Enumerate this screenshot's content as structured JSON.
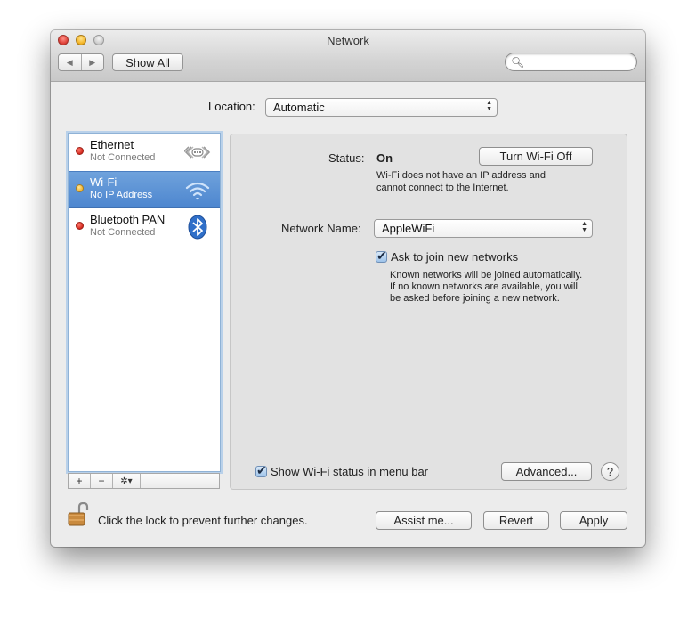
{
  "window": {
    "title": "Network",
    "nav_back": "◀",
    "nav_forward": "▶",
    "show_all_label": "Show All",
    "search_placeholder": "",
    "search_icon": "magnifier-icon"
  },
  "location": {
    "label": "Location:",
    "selected": "Automatic"
  },
  "services": [
    {
      "name": "Ethernet",
      "status": "Not Connected",
      "indicator": "red",
      "icon": "ethernet-icon",
      "selected": false
    },
    {
      "name": "Wi-Fi",
      "status": "No IP Address",
      "indicator": "yellow",
      "icon": "wifi-icon",
      "selected": true
    },
    {
      "name": "Bluetooth PAN",
      "status": "Not Connected",
      "indicator": "red",
      "icon": "bluetooth-icon",
      "selected": false
    }
  ],
  "list_tools": {
    "add": "+",
    "remove": "−",
    "action": "✲▾"
  },
  "detail": {
    "status_label": "Status:",
    "status_value": "On",
    "toggle_button": "Turn Wi-Fi Off",
    "status_desc_1": "Wi-Fi does not have an IP address and",
    "status_desc_2": "cannot connect to the Internet.",
    "network_name_label": "Network Name:",
    "network_name_value": "AppleWiFi",
    "ask_join_label": "Ask to join new networks",
    "ask_join_checked": true,
    "ask_desc_1": "Known networks will be joined automatically.",
    "ask_desc_2": "If no known networks are available, you will",
    "ask_desc_3": "be asked before joining a new network.",
    "show_status_label": "Show Wi-Fi status in menu bar",
    "show_status_checked": true,
    "advanced_button": "Advanced...",
    "help_button": "?"
  },
  "footer": {
    "lock_text": "Click the lock to prevent further changes.",
    "assist_button": "Assist me...",
    "revert_button": "Revert",
    "apply_button": "Apply"
  },
  "colors": {
    "selection": "#5a90d4",
    "indicator_red": "#d3271c",
    "indicator_yellow": "#f1b22b"
  }
}
